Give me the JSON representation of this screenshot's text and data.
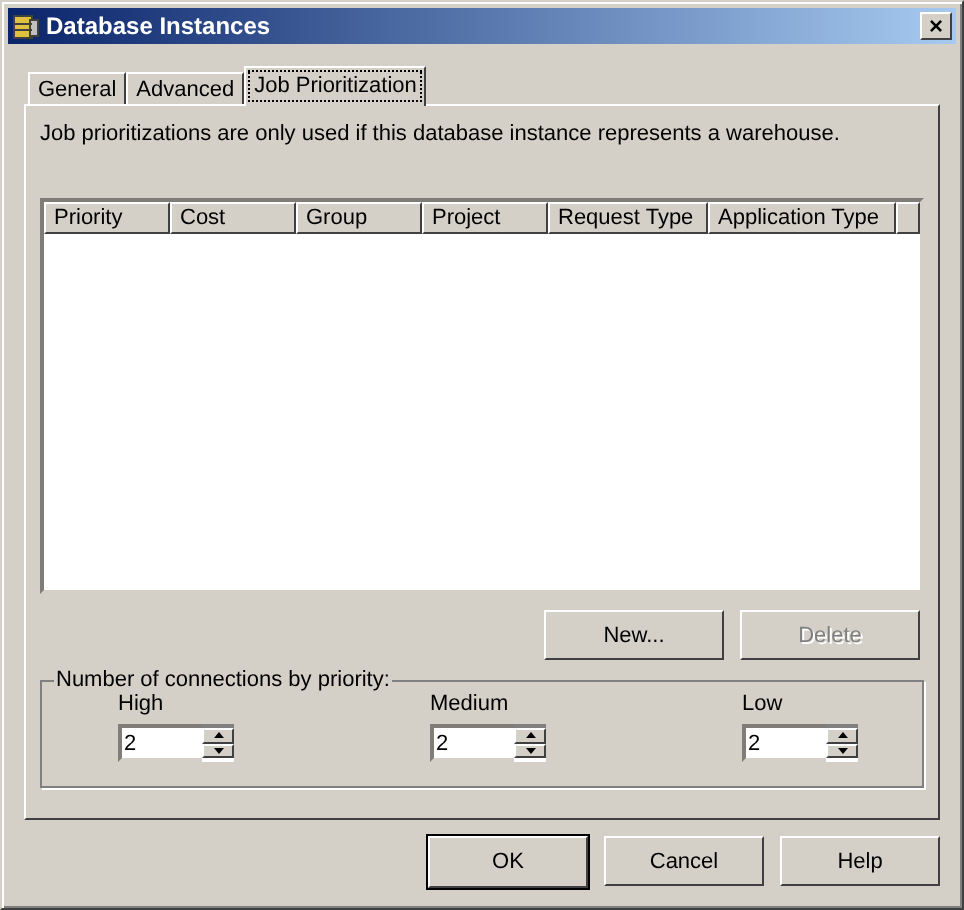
{
  "window": {
    "title": "Database Instances",
    "close": "×"
  },
  "tabs": [
    {
      "label": "General",
      "selected": false
    },
    {
      "label": "Advanced",
      "selected": false
    },
    {
      "label": "Job Prioritization",
      "selected": true
    }
  ],
  "note": "Job prioritizations are only used if this database instance represents a warehouse.",
  "table": {
    "columns": [
      "Priority",
      "Cost",
      "Group",
      "Project",
      "Request Type",
      "Application Type"
    ]
  },
  "list_buttons": [
    {
      "label": "New...",
      "disabled": false
    },
    {
      "label": "Delete",
      "disabled": true
    }
  ],
  "connections": {
    "title": "Number of connections by priority:",
    "fields": [
      {
        "label": "High",
        "value": "2"
      },
      {
        "label": "Medium",
        "value": "2"
      },
      {
        "label": "Low",
        "value": "2"
      }
    ]
  },
  "buttons": [
    {
      "label": "OK",
      "default": true
    },
    {
      "label": "Cancel",
      "default": false
    },
    {
      "label": "Help",
      "default": false
    }
  ]
}
